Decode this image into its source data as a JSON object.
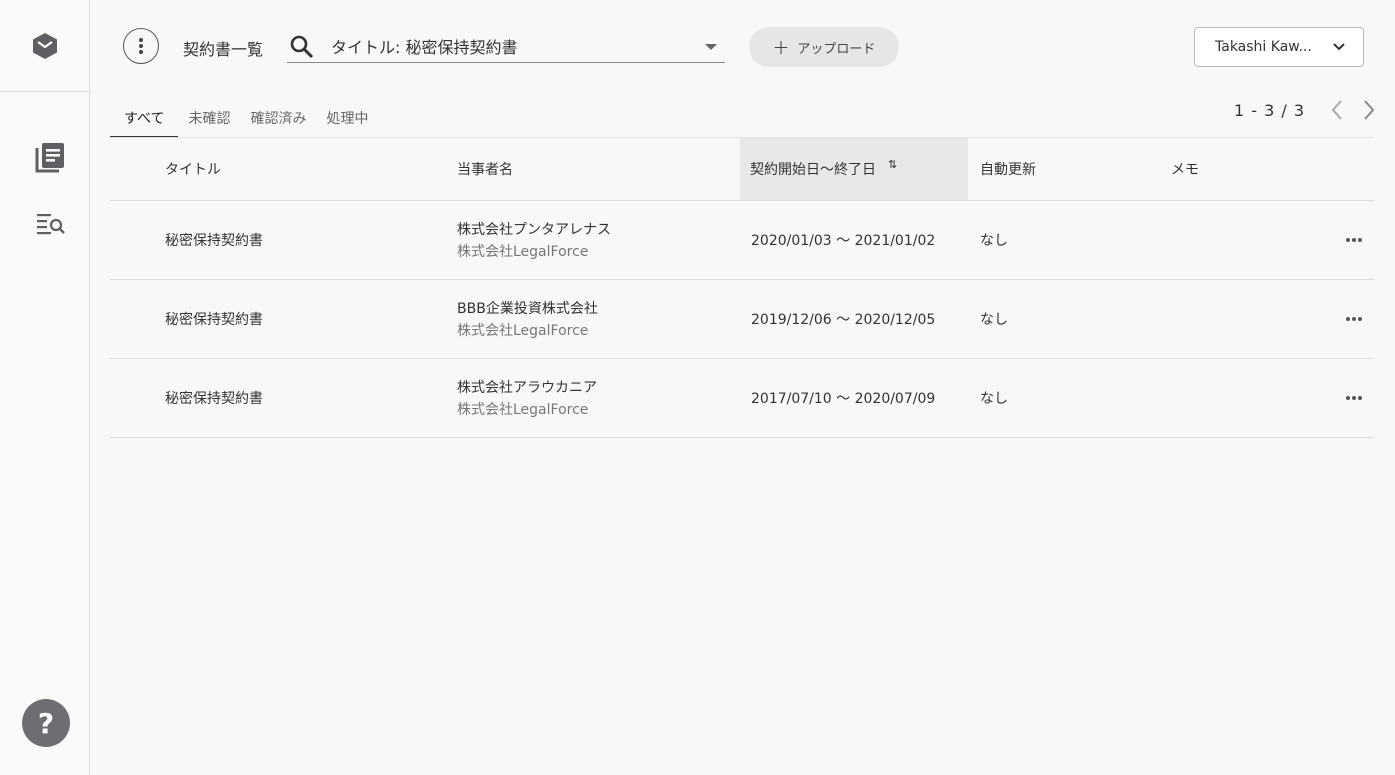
{
  "header": {
    "page_title": "契約書一覧",
    "search_value": "タイトル: 秘密保持契約書",
    "upload_label": "アップロード",
    "user_name": "Takashi Kaw..."
  },
  "tabs": [
    {
      "label": "すべて",
      "active": true
    },
    {
      "label": "未確認"
    },
    {
      "label": "確認済み"
    },
    {
      "label": "処理中"
    }
  ],
  "pager": {
    "count": "1 - 3 / 3"
  },
  "table": {
    "columns": [
      "タイトル",
      "当事者名",
      "契約開始日〜終了日",
      "自動更新",
      "メモ"
    ],
    "sort_icon": "⇅",
    "rows": [
      {
        "title": "秘密保持契約書",
        "party1": "株式会社プンタアレナス",
        "party2": "株式会社LegalForce",
        "period": "2020/01/03 ～ 2021/01/02",
        "renew": "なし",
        "memo": ""
      },
      {
        "title": "秘密保持契約書",
        "party1": "BBB企業投資株式会社",
        "party2": "株式会社LegalForce",
        "period": "2019/12/06 ～ 2020/12/05",
        "renew": "なし",
        "memo": ""
      },
      {
        "title": "秘密保持契約書",
        "party1": "株式会社アラウカニア",
        "party2": "株式会社LegalForce",
        "period": "2017/07/10 ～ 2020/07/09",
        "renew": "なし",
        "memo": ""
      }
    ]
  },
  "sidebar": {
    "help_label": "?"
  },
  "icons": {
    "logo": "box-logo-icon",
    "documents": "document-list-icon",
    "search_list": "list-search-icon",
    "menu": "more-vertical-icon",
    "search": "search-icon",
    "dropdown": "caret-down-icon",
    "user_dropdown": "chevron-down-icon",
    "prev": "chevron-left-icon",
    "next": "chevron-right-icon",
    "row_more": "more-horizontal-icon"
  }
}
